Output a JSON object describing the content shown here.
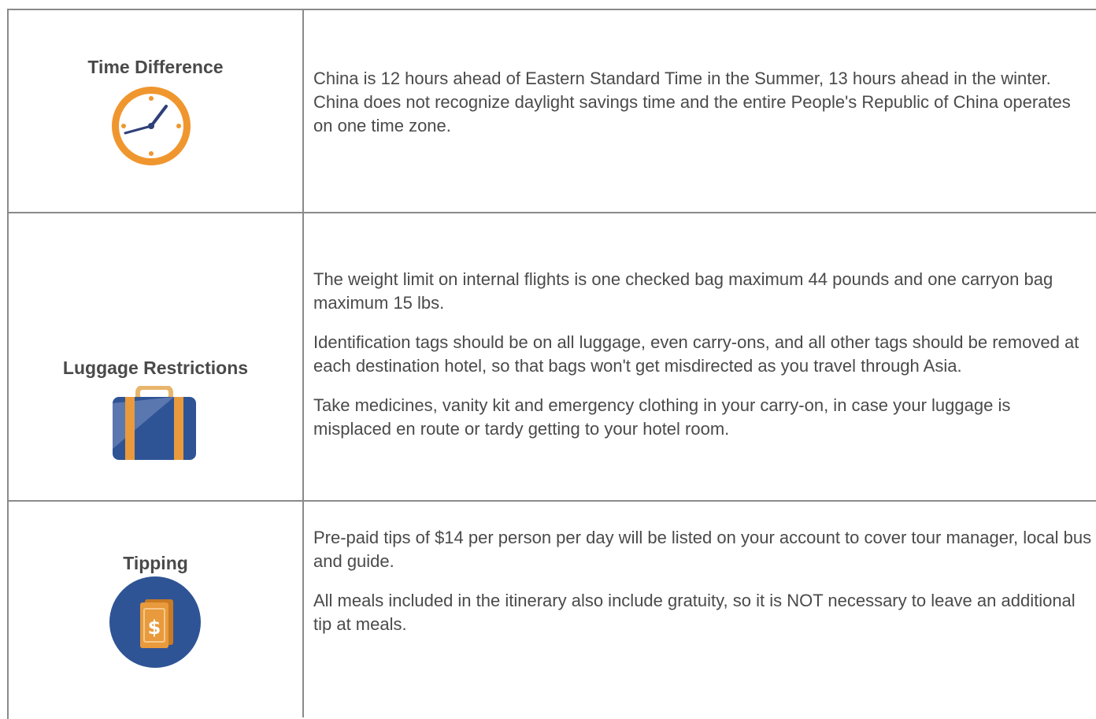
{
  "rows": [
    {
      "label": "Time Difference",
      "icon": "clock-icon",
      "paragraphs": [
        "China is 12 hours ahead of Eastern Standard Time in the Summer, 13 hours ahead in the winter.  China does not recognize daylight savings time and the entire People's Republic of China operates on one time zone."
      ]
    },
    {
      "label": "Luggage Restrictions",
      "icon": "suitcase-icon",
      "paragraphs": [
        "The weight limit on internal flights is one checked bag maximum 44 pounds and one carryon bag maximum 15 lbs.",
        "Identification tags should be on all luggage, even carry-ons, and all other tags should be removed at each destination hotel, so that bags won't get misdirected as you travel through Asia.",
        "Take medicines, vanity kit and emergency clothing in your carry-on, in case your luggage is misplaced en route or tardy getting to your hotel room."
      ]
    },
    {
      "label": "Tipping",
      "icon": "money-icon",
      "paragraphs": [
        "Pre-paid tips of $14 per person per day will be listed on your account to cover tour manager, local bus and guide.",
        "All meals included in the itinerary also include gratuity, so it is NOT necessary to leave an additional tip at meals."
      ]
    }
  ],
  "colors": {
    "border": "#8a8a8a",
    "text": "#4a4a4a",
    "clock_ring": "#f0962e",
    "suitcase_body": "#2f5496",
    "suitcase_strap": "#e89a3c",
    "coin_circle": "#2f5496",
    "bill": "#e89a3c"
  }
}
